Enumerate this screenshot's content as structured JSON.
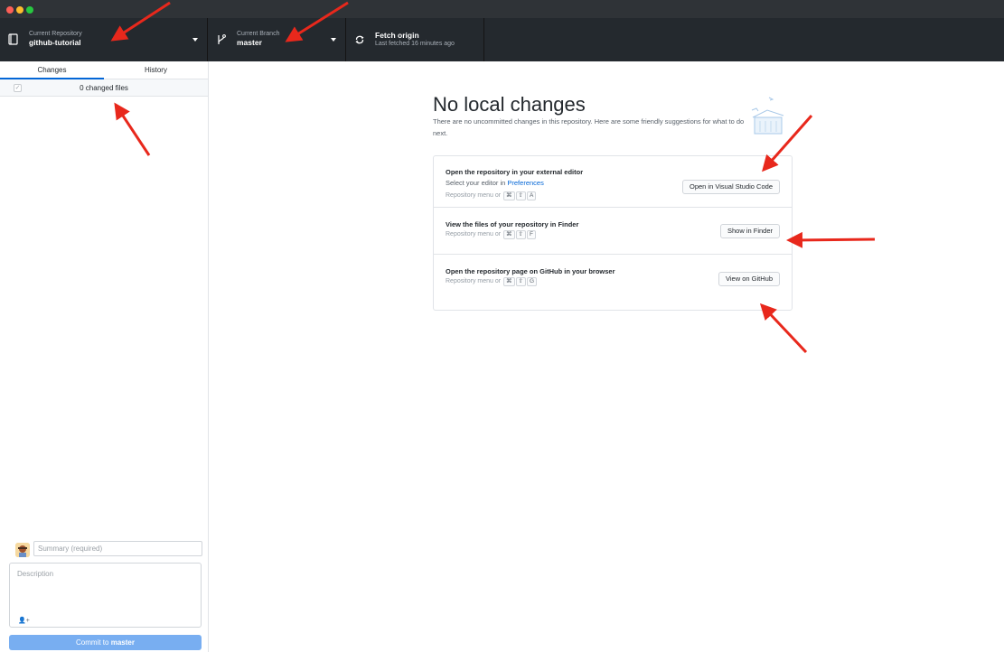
{
  "toolbar": {
    "repo": {
      "caption": "Current Repository",
      "value": "github-tutorial"
    },
    "branch": {
      "caption": "Current Branch",
      "value": "master"
    },
    "fetch": {
      "title": "Fetch origin",
      "subtitle": "Last fetched 16 minutes ago"
    }
  },
  "sidebar": {
    "tabs": [
      {
        "label": "Changes"
      },
      {
        "label": "History"
      }
    ],
    "changed_files": "0 changed files",
    "summary_placeholder": "Summary (required)",
    "description_placeholder": "Description",
    "commit": {
      "prefix": "Commit to",
      "branch": "master"
    }
  },
  "main": {
    "title": "No local changes",
    "description": "There are no uncommitted changes in this repository. Here are some friendly suggestions for what to do next.",
    "cards": [
      {
        "title": "Open the repository in your external editor",
        "subtitle_prefix": "Select your editor in",
        "subtitle_link": "Preferences",
        "hint": "Repository menu or",
        "keys": [
          "⌘",
          "⇧",
          "A"
        ],
        "button": "Open in Visual Studio Code"
      },
      {
        "title": "View the files of your repository in Finder",
        "hint": "Repository menu or",
        "keys": [
          "⌘",
          "⇧",
          "F"
        ],
        "button": "Show in Finder"
      },
      {
        "title": "Open the repository page on GitHub in your browser",
        "hint": "Repository menu or",
        "keys": [
          "⌘",
          "⇧",
          "G"
        ],
        "button": "View on GitHub"
      }
    ]
  },
  "colors": {
    "toolbar": "#24292e",
    "accent": "#0366d6",
    "commit_button": "#78aef1",
    "annotation_arrow": "#e8281c"
  },
  "icons": [
    "repo-icon",
    "branch-icon",
    "sync-icon",
    "caret-down-icon",
    "checkbox-icon",
    "avatar",
    "add-coauthor-icon",
    "illustration",
    "annotation-arrow"
  ]
}
